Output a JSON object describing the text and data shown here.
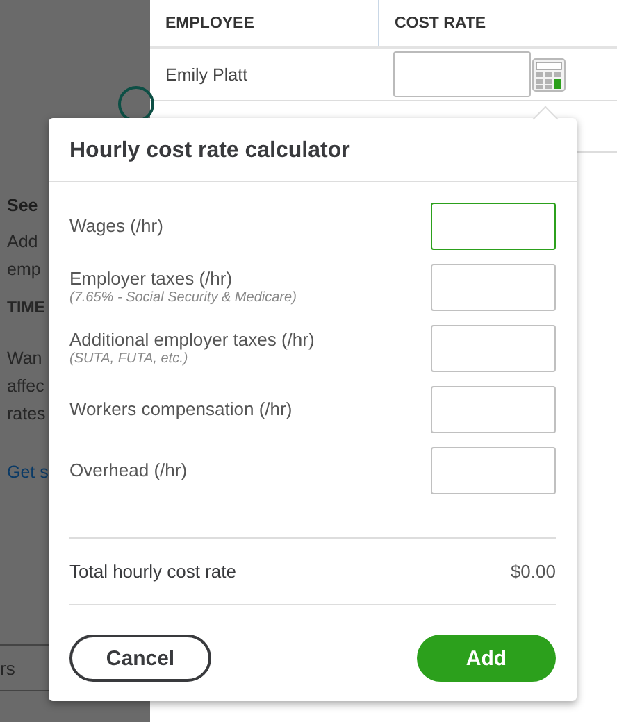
{
  "background_panel": {
    "items": [
      {
        "text": "See",
        "kind": "heading"
      },
      {
        "text": "Add",
        "kind": "body"
      },
      {
        "text": "emp",
        "kind": "body"
      },
      {
        "text": "TIME",
        "kind": "label"
      },
      {
        "text": "Wan",
        "kind": "body"
      },
      {
        "text": "affec",
        "kind": "body"
      },
      {
        "text": "rates",
        "kind": "body"
      },
      {
        "text": "Get s",
        "kind": "link"
      }
    ],
    "footer_tab": "rs"
  },
  "table": {
    "columns": [
      "EMPLOYEE",
      "COST RATE"
    ],
    "rows": [
      {
        "employee": "Emily Platt"
      }
    ]
  },
  "calculator": {
    "title": "Hourly cost rate calculator",
    "fields": [
      {
        "label": "Wages (/hr)",
        "focused": true
      },
      {
        "label": "Employer taxes (/hr)",
        "note": "(7.65% - Social Security & Medicare)",
        "focused": false
      },
      {
        "label": "Additional employer taxes (/hr)",
        "note": "(SUTA, FUTA, etc.)",
        "focused": false
      },
      {
        "label": "Workers compensation (/hr)",
        "focused": false
      },
      {
        "label": "Overhead (/hr)",
        "focused": false
      }
    ],
    "total_label": "Total hourly cost rate",
    "total_value": "$0.00",
    "buttons": [
      {
        "label": "Cancel",
        "kind": "secondary"
      },
      {
        "label": "Add",
        "kind": "primary"
      }
    ]
  }
}
